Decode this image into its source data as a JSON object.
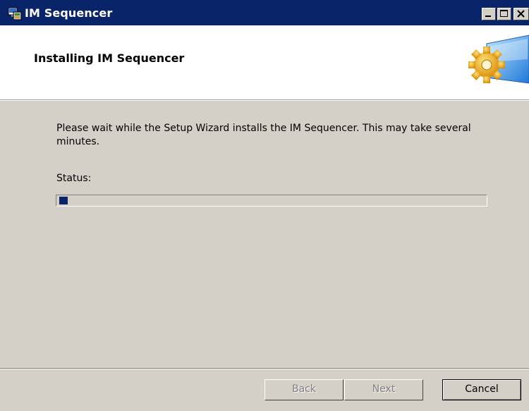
{
  "window": {
    "title": "IM Sequencer",
    "icon": "setup-wizard-icon",
    "controls": {
      "minimize": "minimize-icon",
      "maximize": "maximize-icon",
      "close": "close-icon"
    }
  },
  "banner": {
    "title": "Installing IM Sequencer",
    "graphic": "gear-screen-icon"
  },
  "main": {
    "description": "Please wait while the Setup Wizard installs the IM Sequencer. This may take several minutes.",
    "status_label": "Status:",
    "progress_fraction": 0.02
  },
  "footer": {
    "back_label": "Back",
    "next_label": "Next",
    "cancel_label": "Cancel"
  },
  "colors": {
    "titlebar": "#0a246a",
    "face": "#d4d0c8",
    "progress": "#0a246a"
  }
}
